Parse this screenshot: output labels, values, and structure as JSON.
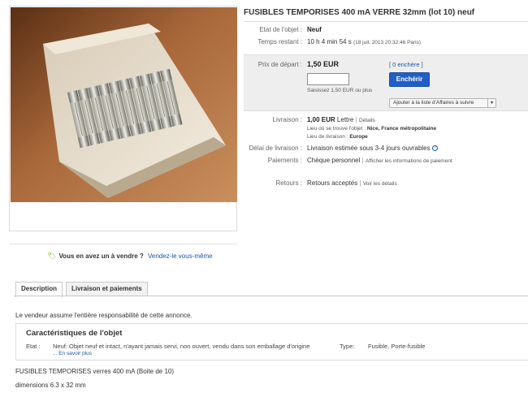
{
  "title": "FUSIBLES TEMPORISES 400 mA VERRE 32mm (lot 10) neuf",
  "photo_alt": "",
  "sell": {
    "question": "Vous en avez un à vendre ?",
    "link": "Vendez-le vous-même"
  },
  "details": {
    "etat_label": "Etat de l'objet :",
    "etat_value": "Neuf",
    "temps_label": "Temps restant :",
    "temps_value": "10 h 4 min 54 s",
    "temps_date": "(18 juil. 2013  20:32:46 Paris)"
  },
  "bid": {
    "prix_label": "Prix de départ :",
    "prix_value": "1,50 EUR",
    "bids_link": "[ 0 enchère ]",
    "input_value": "",
    "hint": "Saisissez 1,50 EUR ou plus",
    "button": "Enchérir",
    "watch": "Ajouter à la liste d'Affaires à suivre"
  },
  "shipping": {
    "livraison_label": "Livraison :",
    "price": "1,00 EUR",
    "method": "Lettre",
    "details_link": "Détails",
    "location_label": "Lieu où se trouve l'objet :",
    "location_value": "Nice, France métropolitaine",
    "ship_to_label": "Lieu de livraison :",
    "ship_to_value": "Europe",
    "delai_label": "Délai de livraison :",
    "delai_value": "Livraison estimée sous 3-4 jours ouvrables",
    "paiements_label": "Paiements :",
    "paiements_value": "Chèque personnel",
    "paiements_link": "Afficher les informations de paiement",
    "retours_label": "Retours :",
    "retours_value": "Retours acceptés",
    "retours_link": "Voir les détails"
  },
  "tabs": [
    "Description",
    "Livraison et paiements"
  ],
  "description": {
    "disclaimer": "Le vendeur assume l'entière responsabilité de cette annonce.",
    "spec_title": "Caractéristiques de l'objet",
    "etat_label": "Etat :",
    "etat_value": "Neuf: Objet neuf et intact, n'ayant jamais servi, non ouvert, vendu dans son emballage d'origine",
    "more_link": "... En savoir plus",
    "type_label": "Type:",
    "type_value": "Fusible, Porte-fusible",
    "line1": "FUSIBLES TEMPORISES verres 400 mA (Boite de 10)",
    "line2": "dimensions 6.3 x 32 mm"
  }
}
